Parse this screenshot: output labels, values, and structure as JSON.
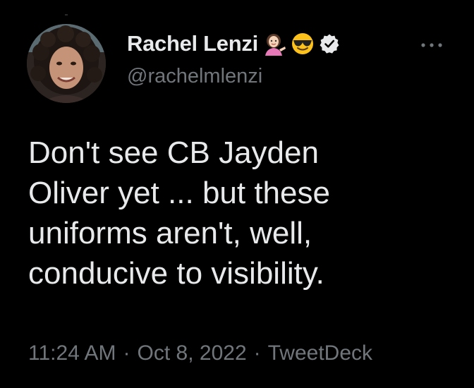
{
  "author": {
    "display_name": "Rachel Lenzi",
    "handle": "@rachelmlenzi",
    "emojis": [
      "woman-tipping-hand-icon",
      "smiling-face-with-sunglasses-icon"
    ],
    "verified": true
  },
  "tweet": {
    "text": "Don't see CB Jayden\nOliver yet ... but these\nuniforms aren't, well,\nconducive to visibility.",
    "time": "11:24 AM",
    "date": "Oct 8, 2022",
    "source": "TweetDeck",
    "separator": "·"
  },
  "colors": {
    "background": "#000000",
    "primary_text": "#e7e9ea",
    "secondary_text": "#71767b"
  }
}
